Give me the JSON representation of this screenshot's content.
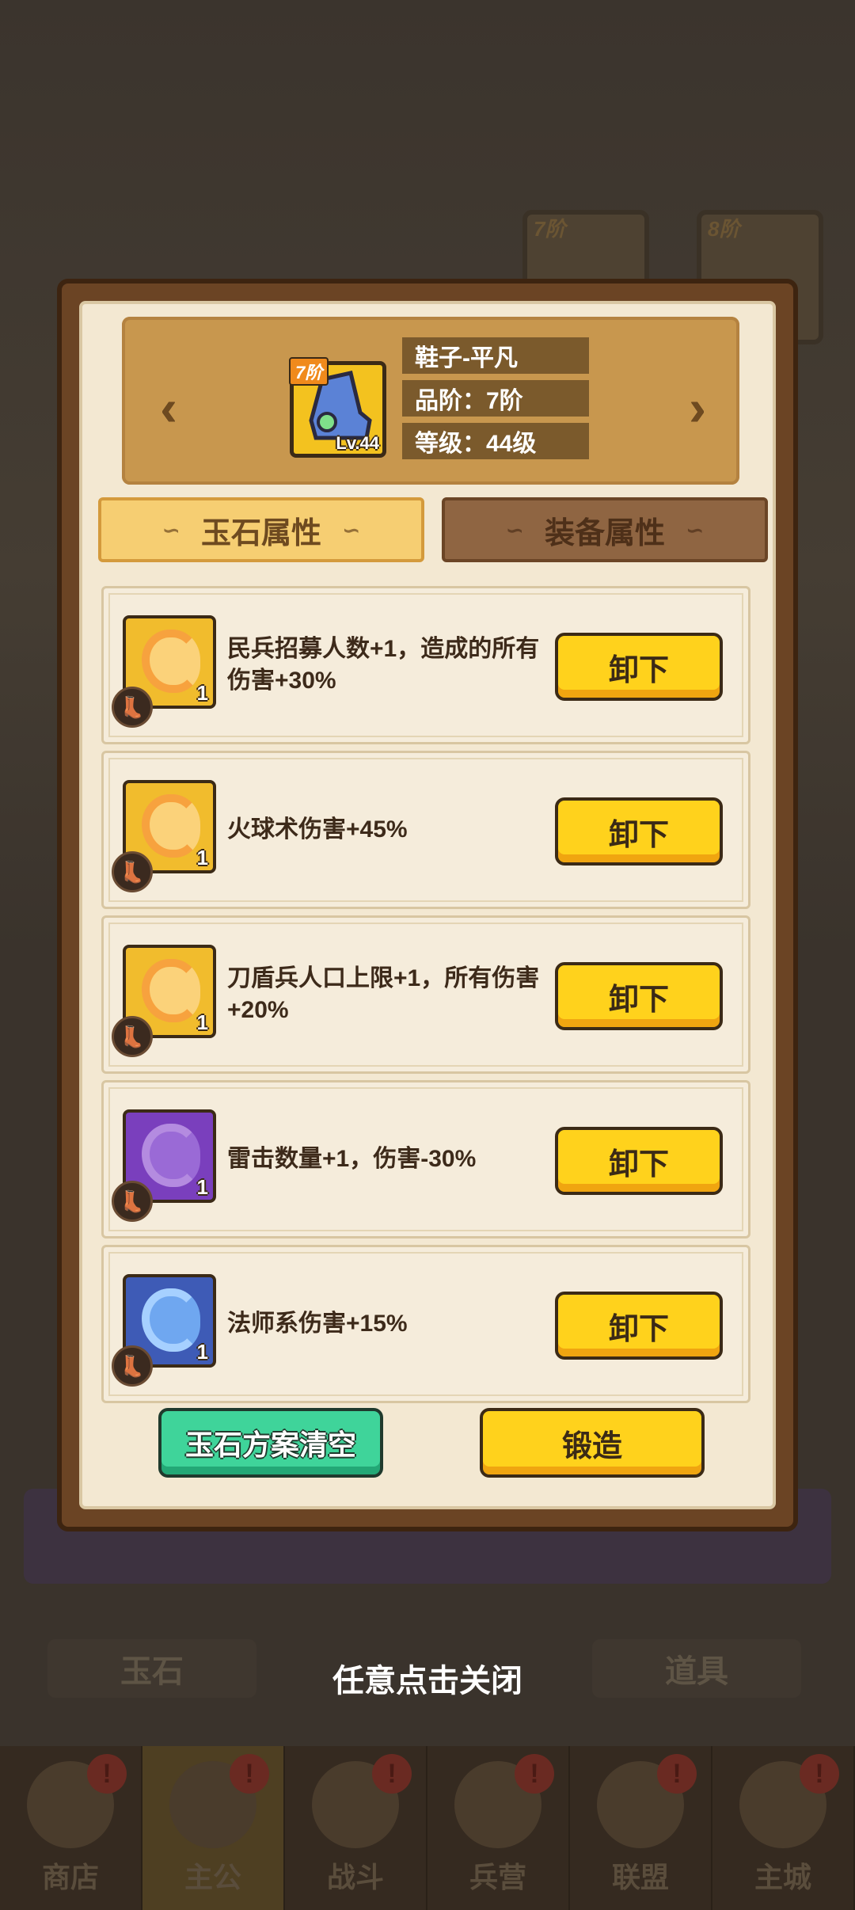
{
  "equipment": {
    "name": "鞋子-平凡",
    "quality": "品阶：7阶",
    "level": "等级：44级",
    "tier_badge": "7阶",
    "lv_label": "Lv.44"
  },
  "tabs": {
    "jade_attr": "玉石属性",
    "equip_attr": "装备属性"
  },
  "jades": [
    {
      "color": "gold",
      "count": "1",
      "desc": "民兵招募人数+1，造成的所有伤害+30%",
      "button": "卸下"
    },
    {
      "color": "gold",
      "count": "1",
      "desc": "火球术伤害+45%",
      "button": "卸下"
    },
    {
      "color": "gold",
      "count": "1",
      "desc": "刀盾兵人口上限+1，所有伤害+20%",
      "button": "卸下"
    },
    {
      "color": "purple",
      "count": "1",
      "desc": "雷击数量+1，伤害-30%",
      "button": "卸下"
    },
    {
      "color": "blue",
      "count": "1",
      "desc": "法师系伤害+15%",
      "button": "卸下"
    }
  ],
  "footer": {
    "clear_label": "玉石方案清空",
    "forge_label": "锻造"
  },
  "close_hint": "任意点击关闭",
  "background": {
    "slot_tiers": [
      "7阶",
      "8阶"
    ],
    "tabs": [
      "玉石",
      "道具"
    ],
    "nav": [
      {
        "label": "商店",
        "alert": "!"
      },
      {
        "label": "主公",
        "alert": "!"
      },
      {
        "label": "战斗",
        "alert": "!"
      },
      {
        "label": "兵营",
        "alert": "!"
      },
      {
        "label": "联盟",
        "alert": "!"
      },
      {
        "label": "主城",
        "alert": "!"
      }
    ]
  }
}
